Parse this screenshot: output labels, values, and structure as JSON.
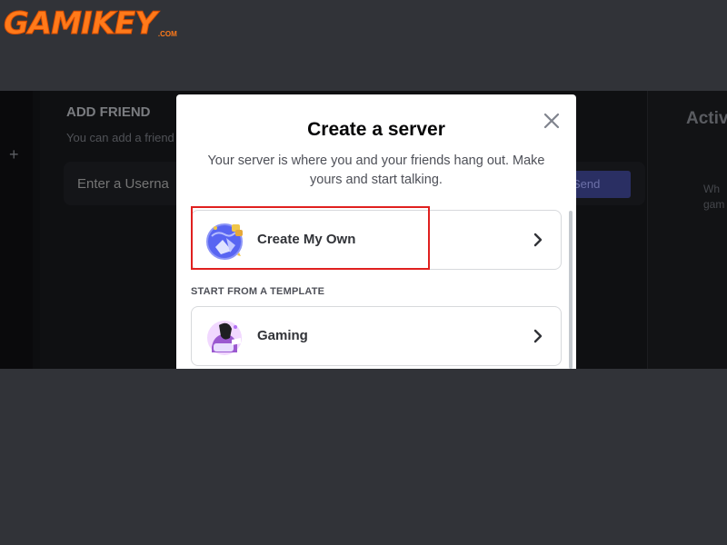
{
  "watermark": {
    "brand": "GAMIKEY",
    "suffix": ".COM"
  },
  "background_app": {
    "add_friend_title": "ADD FRIEND",
    "add_friend_desc": "You can add a friend",
    "input_placeholder": "Enter a Userna",
    "send_button": "Send Friend Request",
    "active_title": "Activ",
    "active_desc_line1": "Wh",
    "active_desc_line2": "gam"
  },
  "modal": {
    "title": "Create a server",
    "subtitle": "Your server is where you and your friends hang out. Make yours and start talking.",
    "options": [
      {
        "label": "Create My Own",
        "icon": "globe-icon"
      },
      {
        "label": "Gaming",
        "icon": "gaming-icon"
      }
    ],
    "section_label": "START FROM A TEMPLATE",
    "close_icon": "close-icon"
  },
  "colors": {
    "highlight": "#e0201f",
    "brand_orange": "#ff7a1a",
    "blurple": "#5865f2"
  }
}
